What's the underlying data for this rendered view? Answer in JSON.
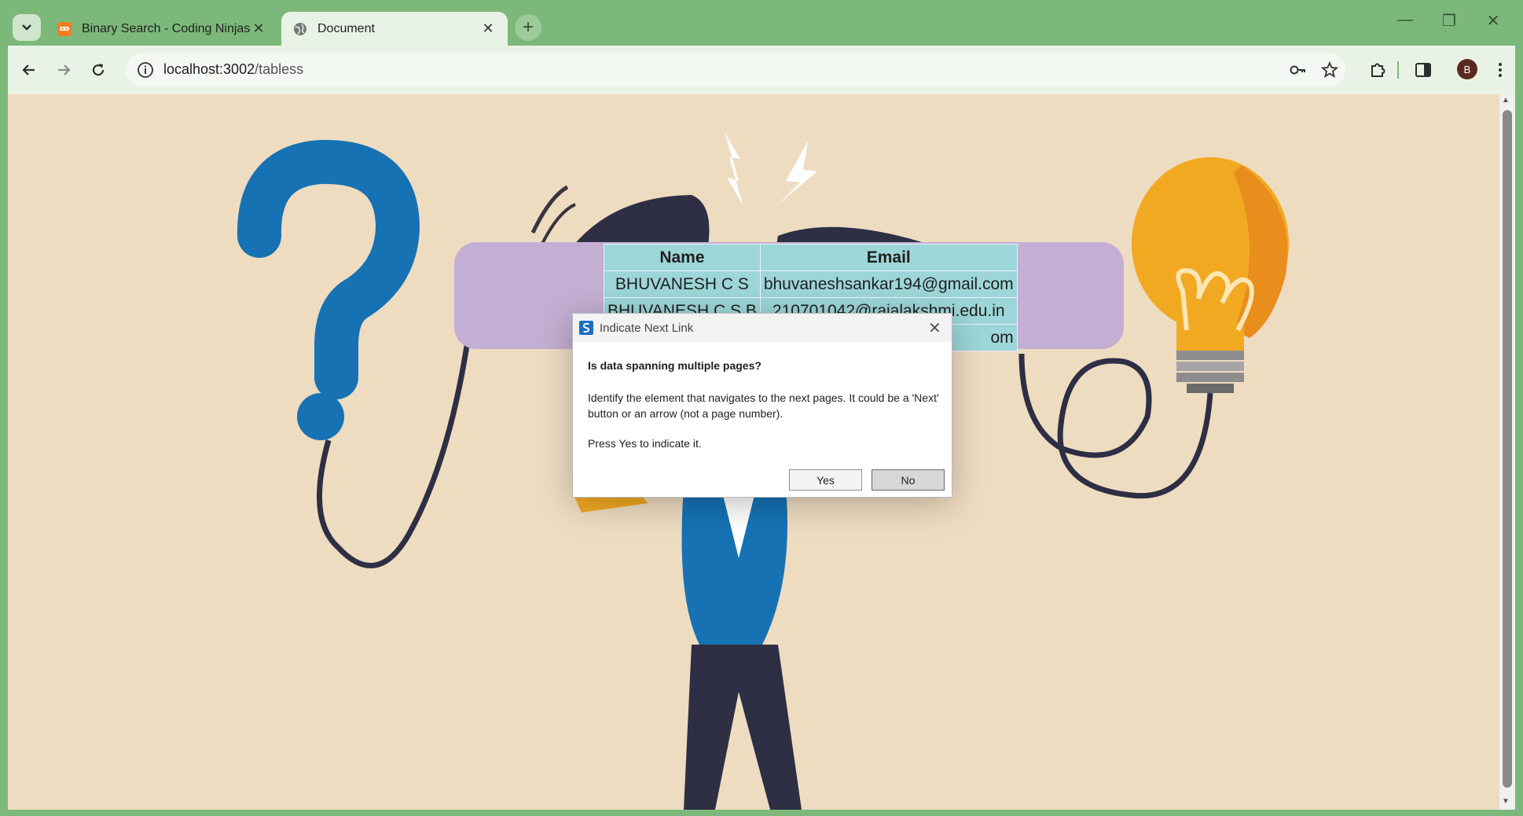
{
  "browser": {
    "tabs": [
      {
        "title": "Binary Search - Coding Ninjas",
        "favicon": "coding-ninjas-icon"
      },
      {
        "title": "Document",
        "favicon": "globe-icon"
      }
    ],
    "url_host": "localhost:3002",
    "url_path": "/tabless",
    "profile_initial": "B"
  },
  "table": {
    "headers": [
      "Name",
      "Email"
    ],
    "rows": [
      [
        "BHUVANESH C S",
        "bhuvaneshsankar194@gmail.com"
      ],
      [
        "BHUVANESH C S B",
        "210701042@rajalakshmi.edu.in"
      ],
      [
        "",
        "om"
      ]
    ]
  },
  "dialog": {
    "title": "Indicate Next Link",
    "question": "Is data spanning multiple pages?",
    "message": "Identify the element that navigates to the next pages. It could be a 'Next' button or an arrow (not a page number).",
    "instruction": "Press Yes to indicate it.",
    "yes_label": "Yes",
    "no_label": "No"
  },
  "colors": {
    "browser_frame": "#7cb87a",
    "page_background": "#eedcc1",
    "panel": "#c4aed3",
    "table_cells": "#9dd6d8"
  }
}
